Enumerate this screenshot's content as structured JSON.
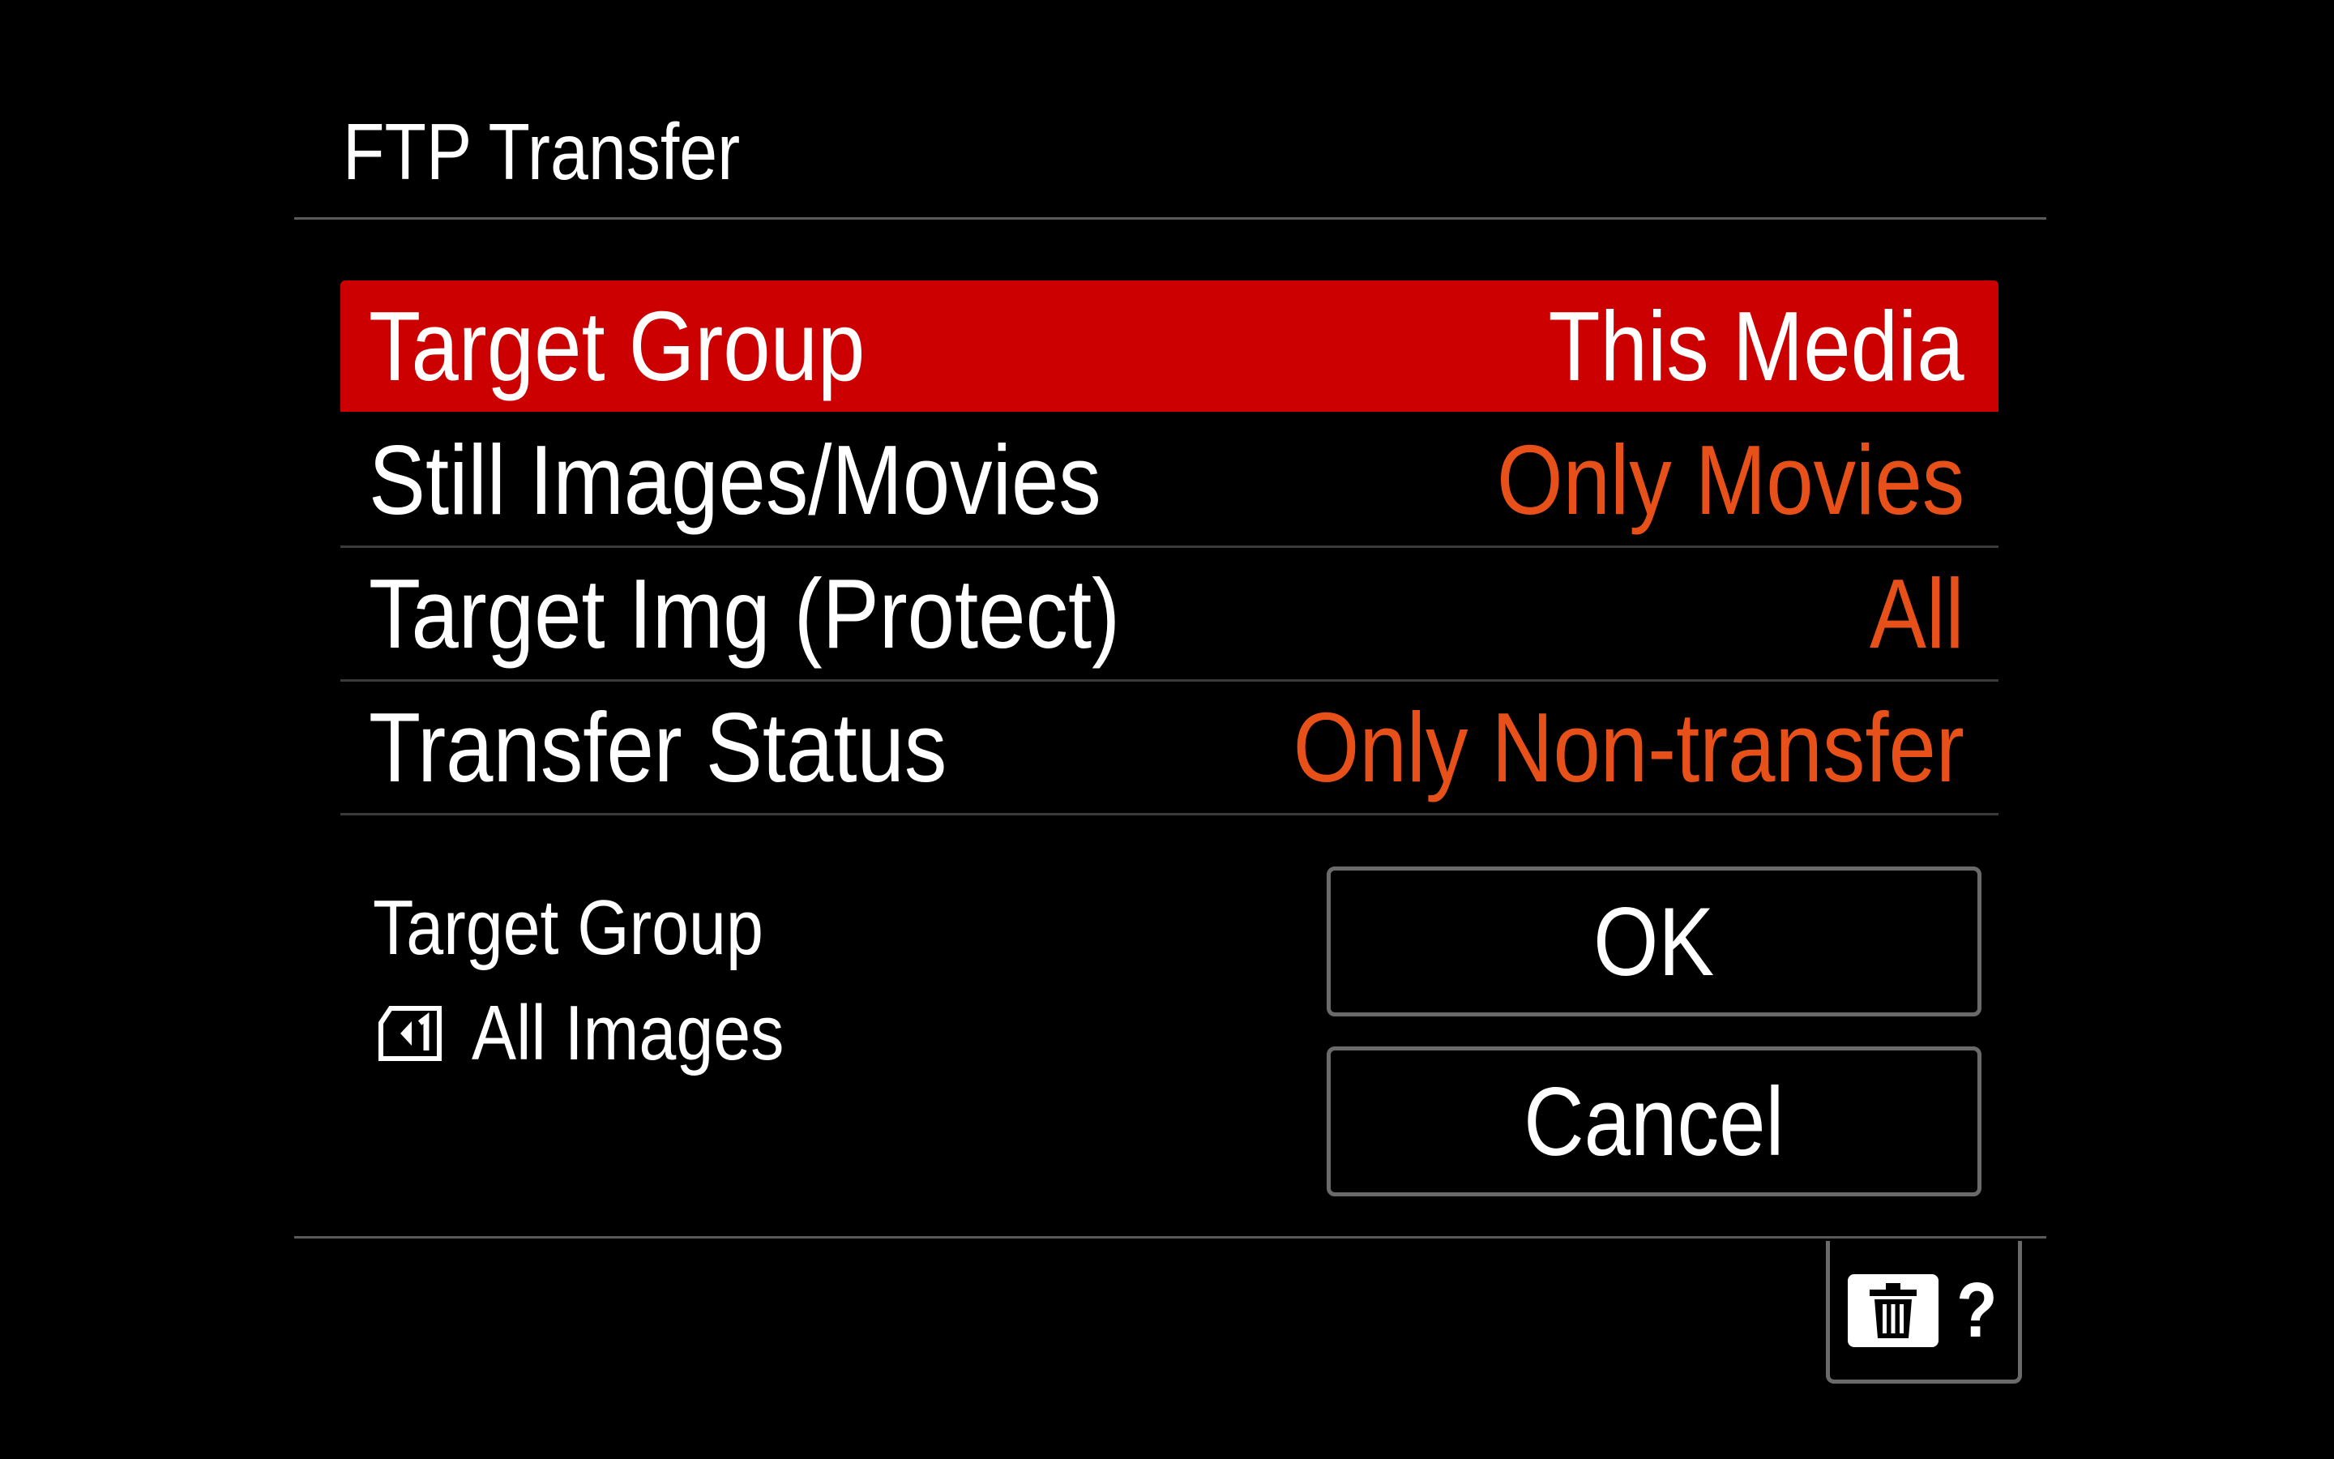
{
  "screen": {
    "title": "FTP Transfer"
  },
  "menu": {
    "items": [
      {
        "label": "Target Group",
        "value": "This Media",
        "selected": true
      },
      {
        "label": "Still Images/Movies",
        "value": "Only Movies"
      },
      {
        "label": "Target Img (Protect)",
        "value": "All"
      },
      {
        "label": "Transfer Status",
        "value": "Only Non-transfer"
      }
    ]
  },
  "info": {
    "heading": "Target Group",
    "icon": "memory-card-slot-1-icon",
    "value": "All Images"
  },
  "buttons": {
    "ok_label": "OK",
    "cancel_label": "Cancel"
  },
  "footer": {
    "delete_icon": "trash-icon",
    "help_label": "?"
  },
  "colors": {
    "background": "#000000",
    "selection": "#cc0000",
    "value_accent": "#e8501a",
    "text": "#ffffff",
    "divider": "#5a5a5a"
  }
}
